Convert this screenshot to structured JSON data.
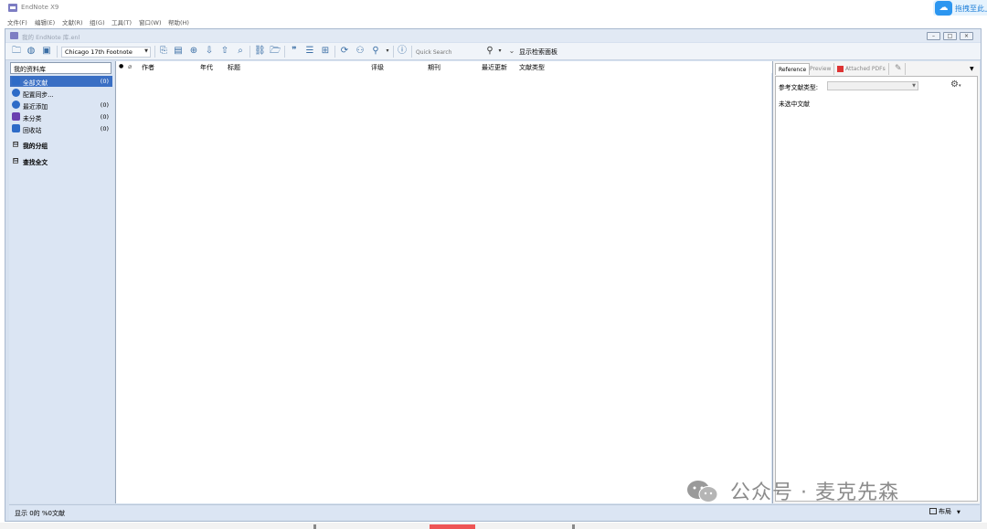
{
  "window": {
    "app_title": "EndNote X9",
    "doc_title": "我的 EndNote 库.enl"
  },
  "overlay": {
    "text": "拖拽至此上"
  },
  "menu": [
    "文件(F)",
    "编辑(E)",
    "文献(R)",
    "组(G)",
    "工具(T)",
    "窗口(W)",
    "帮助(H)"
  ],
  "toolbar": {
    "style": "Chicago 17th Footnote",
    "quick_search_placeholder": "Quick Search",
    "search_panel_label": "显示检索面板"
  },
  "library": {
    "header": "我的资料库",
    "groups": [
      {
        "label": "全部文献",
        "count": "(0)",
        "selected": true,
        "icon": "book-icon",
        "color": "#2e6bc7"
      },
      {
        "label": "配置同步...",
        "count": "",
        "selected": false,
        "icon": "sync-icon",
        "color": "#2e6bc7"
      },
      {
        "label": "最近添加",
        "count": "(0)",
        "selected": false,
        "icon": "clock-icon",
        "color": "#2e6bc7"
      },
      {
        "label": "未分类",
        "count": "(0)",
        "selected": false,
        "icon": "unfiled-icon",
        "color": "#6a3fb0"
      },
      {
        "label": "回收站",
        "count": "(0)",
        "selected": false,
        "icon": "trash-icon",
        "color": "#2e6bc7"
      }
    ],
    "sections": [
      {
        "label": "我的分组",
        "toggle": "⊟"
      },
      {
        "label": "查找全文",
        "toggle": "⊟"
      }
    ]
  },
  "columns": [
    "作者",
    "年代",
    "标题",
    "评级",
    "期刊",
    "最近更新",
    "文献类型"
  ],
  "right_panel": {
    "tabs": [
      "Reference",
      "Preview",
      "Attached PDFs"
    ],
    "active_tab": "Reference",
    "type_label": "参考文献类型:",
    "empty_text": "未选中文献",
    "menu_arrow": "▼"
  },
  "status": {
    "text": "显示 0的 %0文献",
    "layout_label": "布局"
  },
  "watermark": {
    "text": "公众号 · 麦克先森"
  }
}
